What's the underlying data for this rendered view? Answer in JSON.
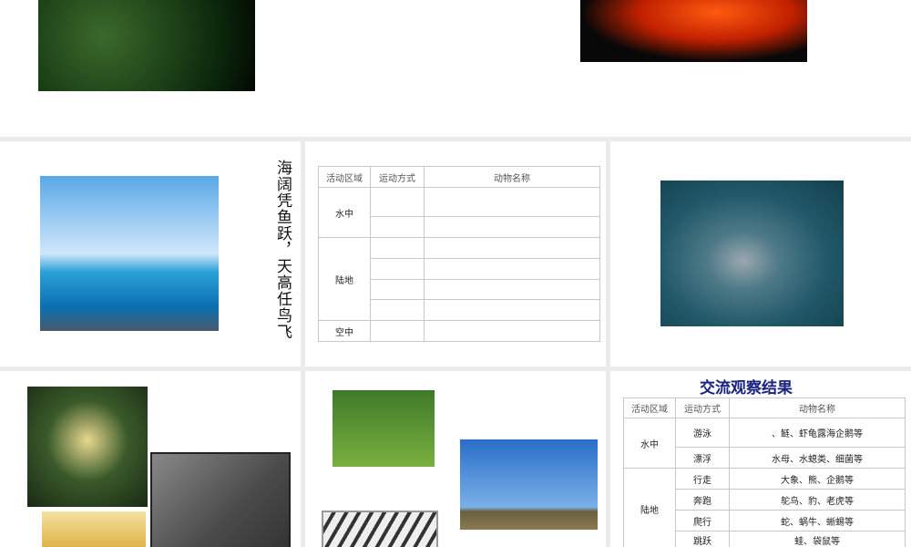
{
  "slide2": {
    "vertical_text": "海阔凭鱼跃，天高任鸟飞"
  },
  "table_header": [
    "活动区域",
    "运动方式",
    "动物名称"
  ],
  "blank_table": {
    "regions": [
      "水中",
      "陆地",
      "空中"
    ]
  },
  "results": {
    "title": "交流观察结果",
    "rows": [
      {
        "region": "水中",
        "mode": "游泳",
        "animals": "、鲢、虾龟露海企鹅等"
      },
      {
        "mode": "漂浮",
        "animals": "水母、水螅类、细菌等"
      },
      {
        "region": "陆地",
        "mode": "行走",
        "animals": "大象、熊、企鹅等"
      },
      {
        "mode": "奔跑",
        "animals": "鸵鸟、豹、老虎等"
      },
      {
        "mode": "爬行",
        "animals": "蛇、蜗牛、蜥蜴等"
      },
      {
        "mode": "跳跃",
        "animals": "蛙、袋鼠等"
      }
    ]
  }
}
